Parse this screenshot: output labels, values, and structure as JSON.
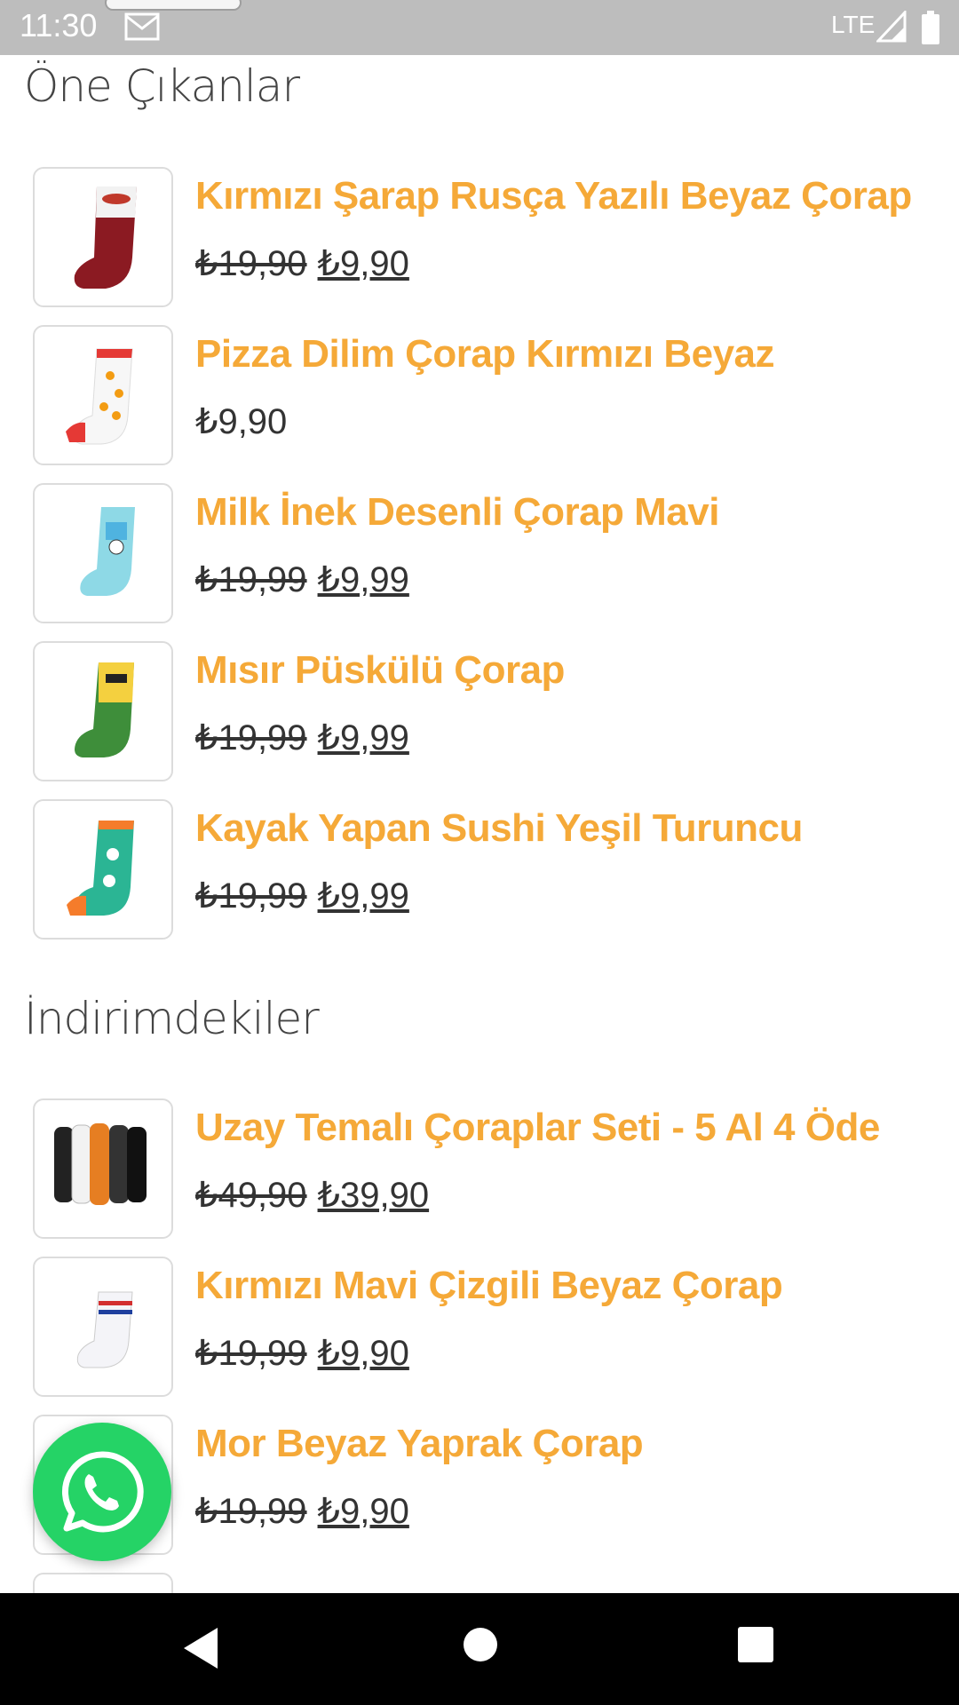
{
  "status_bar": {
    "time": "11:30",
    "network": "LTE",
    "icons": [
      "mail-icon",
      "signal-icon",
      "battery-icon"
    ]
  },
  "sections": [
    {
      "title": "Öne Çıkanlar",
      "items": [
        {
          "name": "Kırmızı Şarap Rusça Yazılı Beyaz Çorap",
          "old_price": "₺19,90",
          "price": "₺9,90"
        },
        {
          "name": "Pizza Dilim Çorap Kırmızı Beyaz",
          "old_price": "",
          "price": "₺9,90"
        },
        {
          "name": "Milk İnek Desenli Çorap Mavi",
          "old_price": "₺19,99",
          "price": "₺9,99"
        },
        {
          "name": "Mısır Püskülü Çorap",
          "old_price": "₺19,99",
          "price": "₺9,99"
        },
        {
          "name": "Kayak Yapan Sushi Yeşil Turuncu",
          "old_price": "₺19,99",
          "price": "₺9,99"
        }
      ]
    },
    {
      "title": "İndirimdekiler",
      "items": [
        {
          "name": "Uzay Temalı Çoraplar Seti - 5 Al 4 Öde",
          "old_price": "₺49,90",
          "price": "₺39,90"
        },
        {
          "name": "Kırmızı Mavi Çizgili Beyaz Çorap",
          "old_price": "₺19,99",
          "price": "₺9,90"
        },
        {
          "name": "Mor Beyaz Yaprak Çorap",
          "old_price": "₺19,99",
          "price": "₺9,90"
        }
      ]
    }
  ],
  "colors": {
    "accent": "#f5a938",
    "whatsapp": "#25d366",
    "status_bar": "#bdbdbd",
    "nav_bar": "#000000"
  },
  "floating_button": {
    "icon": "whatsapp-icon"
  },
  "nav_bar": {
    "icons": [
      "back-icon",
      "home-icon",
      "recents-icon"
    ]
  }
}
